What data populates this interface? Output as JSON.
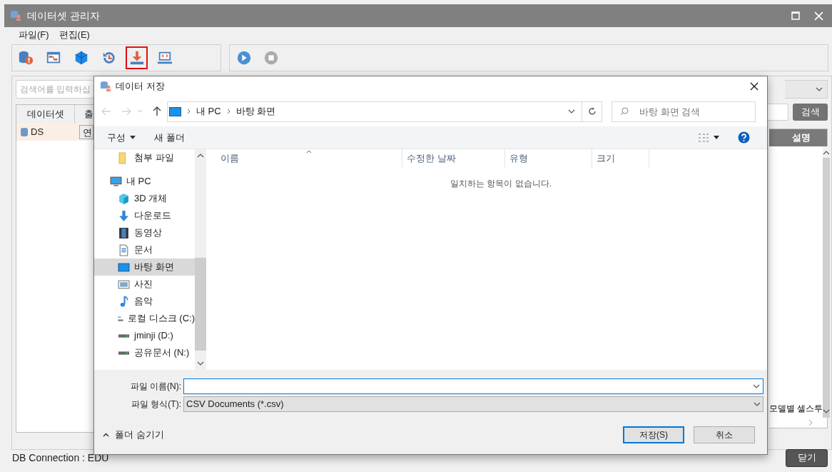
{
  "window": {
    "title": "데이터셋 관리자"
  },
  "menu": [
    {
      "label": "파일(F)"
    },
    {
      "label": "편집(E)"
    }
  ],
  "toolbar": [
    {
      "kind": "db-alert",
      "selected": false
    },
    {
      "kind": "flow",
      "selected": false
    },
    {
      "kind": "cube",
      "selected": false
    },
    {
      "kind": "history",
      "selected": false
    },
    {
      "kind": "download",
      "selected": true
    },
    {
      "kind": "monitor",
      "selected": false
    }
  ],
  "run_controls": [
    {
      "kind": "play",
      "disabled": false
    },
    {
      "kind": "stop",
      "disabled": true
    }
  ],
  "dataset_panel": {
    "search": {
      "placeholder": "검색어를 입력하십"
    },
    "columns": [
      "데이터셋",
      "출"
    ],
    "rows": [
      {
        "name": "DS",
        "action": "연",
        "selected": true
      }
    ]
  },
  "detail_panel": {
    "search_button": "검색",
    "columns": [
      "설명"
    ],
    "rows": [
      {
        "text": "모델별 셀스투"
      }
    ]
  },
  "status_bar": {
    "connection": "DB Connection : EDU"
  },
  "close_button": "닫기",
  "dialog": {
    "title": "데이터 저장",
    "breadcrumb": [
      "내 PC",
      "바탕 화면"
    ],
    "search": {
      "placeholder": "바탕 화면 검색"
    },
    "commands": [
      {
        "label": "구성",
        "dropdown": true
      },
      {
        "label": "새 폴더",
        "dropdown": false
      }
    ],
    "nav": [
      {
        "label": "첨부 파일",
        "kind": "folder",
        "selected": false
      },
      {
        "label": "내 PC",
        "kind": "pc",
        "selected": false,
        "children": [
          {
            "label": "3D 개체",
            "kind": "cube3d",
            "selected": false
          },
          {
            "label": "다운로드",
            "kind": "download",
            "selected": false
          },
          {
            "label": "동영상",
            "kind": "film",
            "selected": false
          },
          {
            "label": "문서",
            "kind": "document",
            "selected": false
          },
          {
            "label": "바탕 화면",
            "kind": "desktop",
            "selected": true
          },
          {
            "label": "사진",
            "kind": "picture",
            "selected": false
          },
          {
            "label": "음악",
            "kind": "music",
            "selected": false
          },
          {
            "label": "로컬 디스크 (C:)",
            "kind": "system-drive",
            "selected": false
          },
          {
            "label": "jminji (D:)",
            "kind": "drive",
            "selected": false
          },
          {
            "label": "공유문서 (N:)",
            "kind": "drive",
            "selected": false
          }
        ]
      }
    ],
    "columns": [
      "이름",
      "수정한 날짜",
      "유형",
      "크기"
    ],
    "empty_message": "일치하는 항목이 없습니다.",
    "file_name": {
      "label": "파일 이름(N):"
    },
    "file_type": {
      "label": "파일 형식(T):",
      "value": "CSV Documents (*.csv)"
    },
    "hide_folders": "폴더 숨기기",
    "buttons": [
      {
        "label": "저장(S)",
        "default": true
      },
      {
        "label": "취소",
        "default": false
      }
    ]
  }
}
